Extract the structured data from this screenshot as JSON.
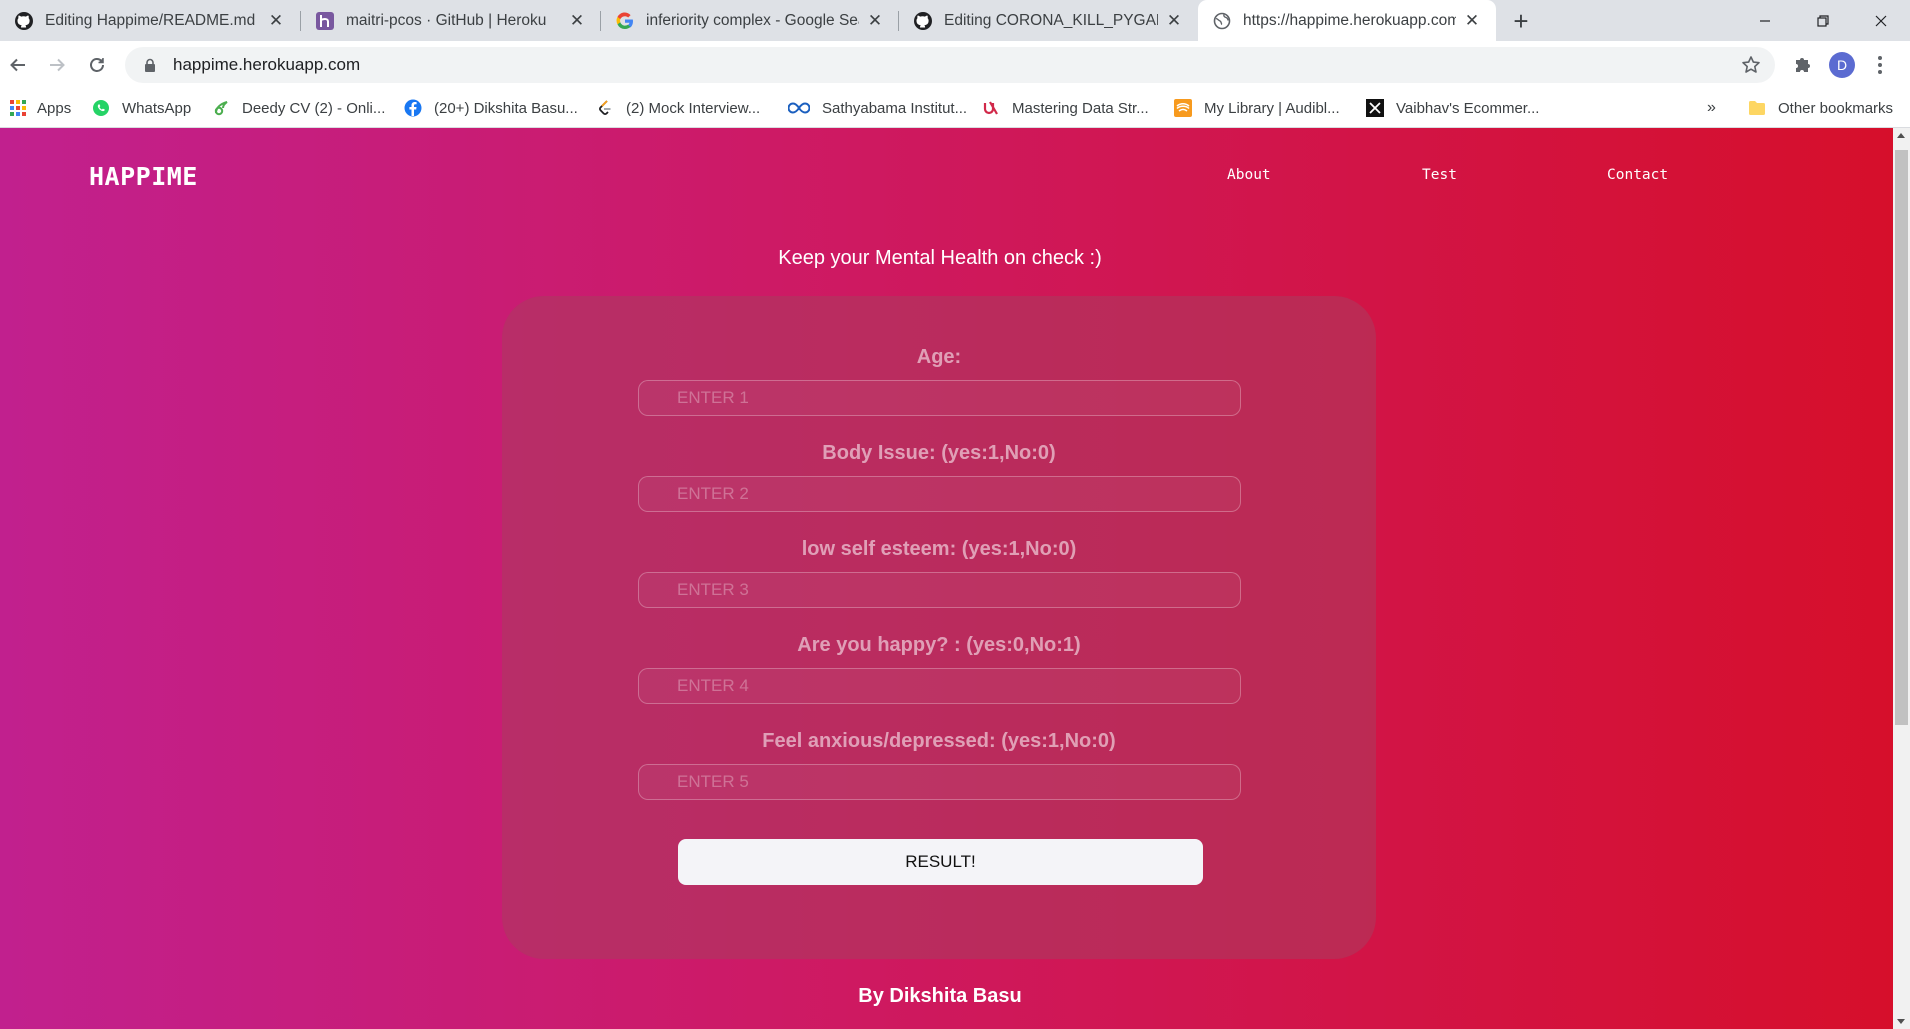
{
  "browser": {
    "tabs": [
      {
        "title": "Editing Happime/README.md at",
        "icon": "github-icon"
      },
      {
        "title": "maitri-pcos · GitHub | Heroku",
        "icon": "heroku-icon"
      },
      {
        "title": "inferiority complex - Google Sear",
        "icon": "google-icon"
      },
      {
        "title": "Editing CORONA_KILL_PYGAME.",
        "icon": "github-icon"
      },
      {
        "title": "https://happime.herokuapp.com",
        "icon": "globe-icon",
        "active": true
      }
    ],
    "url": "happime.herokuapp.com",
    "profile_initial": "D",
    "bookmarks": [
      {
        "label": "Apps",
        "icon": "apps-grid-icon"
      },
      {
        "label": "WhatsApp",
        "icon": "whatsapp-icon"
      },
      {
        "label": "Deedy CV (2) - Onli...",
        "icon": "overleaf-icon"
      },
      {
        "label": "(20+) Dikshita Basu...",
        "icon": "facebook-icon"
      },
      {
        "label": "(2) Mock Interview...",
        "icon": "leetcode-icon"
      },
      {
        "label": "Sathyabama Institut...",
        "icon": "infinity-icon"
      },
      {
        "label": "Mastering Data Str...",
        "icon": "udemy-icon"
      },
      {
        "label": "My Library | Audibl...",
        "icon": "audible-icon"
      },
      {
        "label": "Vaibhav's Ecommer...",
        "icon": "ecommerce-icon"
      }
    ],
    "bookmarks_more": "»",
    "other_bookmarks": "Other bookmarks"
  },
  "page": {
    "logo": "HAPPIME",
    "nav": [
      "About",
      "Test",
      "Contact"
    ],
    "tagline": "Keep your Mental Health on check :)",
    "fields": [
      {
        "label": "Age:",
        "placeholder": "ENTER 1"
      },
      {
        "label": "Body Issue: (yes:1,No:0)",
        "placeholder": "ENTER 2"
      },
      {
        "label": "low self esteem: (yes:1,No:0)",
        "placeholder": "ENTER 3"
      },
      {
        "label": "Are you happy? : (yes:0,No:1)",
        "placeholder": "ENTER 4"
      },
      {
        "label": "Feel anxious/depressed: (yes:1,No:0)",
        "placeholder": "ENTER 5"
      }
    ],
    "submit_label": "RESULT!",
    "credit": "By Dikshita Basu"
  },
  "colors": {
    "gradient_start": "#c1208e",
    "gradient_end": "#d60f2b",
    "card": "#aa3c5f"
  }
}
